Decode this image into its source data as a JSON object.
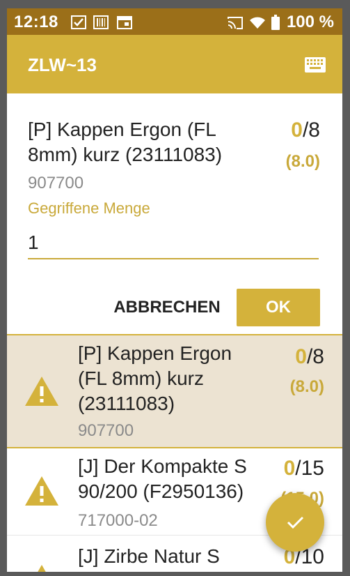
{
  "statusbar": {
    "time": "12:18",
    "battery": "100 %",
    "icons": [
      "checkbox-notification-icon",
      "barcode-notification-icon",
      "calendar-notification-icon",
      "cast-icon",
      "wifi-icon",
      "battery-icon"
    ]
  },
  "appbar": {
    "title": "ZLW~13",
    "action_icon": "keyboard-icon"
  },
  "dialog": {
    "item_name": "[P] Kappen Ergon (FL 8mm) kurz (23111083)",
    "count_done": "0",
    "count_total": "/8",
    "sub": "(8.0)",
    "code": "907700",
    "field_label": "Gegriffene Menge",
    "field_value": "1",
    "cancel_label": "ABBRECHEN",
    "ok_label": "OK"
  },
  "list": [
    {
      "name": "[P] Kappen Ergon (FL 8mm) kurz (23111083)",
      "count_done": "0",
      "count_total": "/8",
      "sub": "(8.0)",
      "code": "907700",
      "selected": true
    },
    {
      "name": "[J] Der Kompakte S 90/200 (F2950136)",
      "count_done": "0",
      "count_total": "/15",
      "sub": "(15.0)",
      "code": "717000-02",
      "selected": false
    },
    {
      "name": "[J] Zirbe Natur S",
      "count_done": "0",
      "count_total": "/10",
      "selected": false
    }
  ],
  "fab_icon": "checkmark-icon",
  "colors": {
    "accent": "#d4b23b",
    "statusbar": "#9b6f19",
    "selected_bg": "#ece3d2"
  }
}
